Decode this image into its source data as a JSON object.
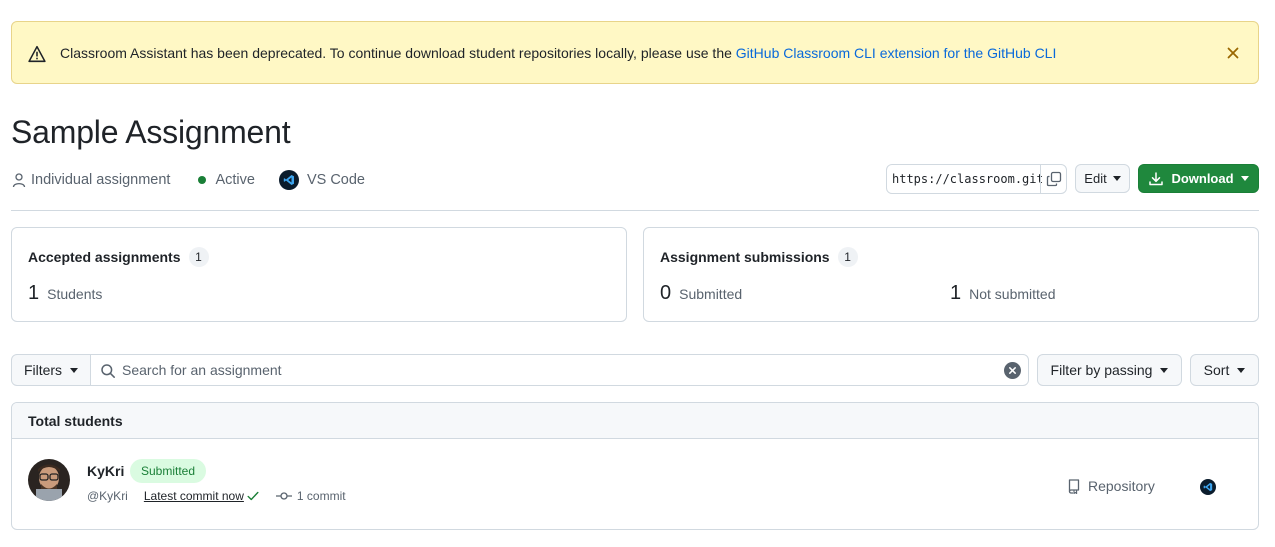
{
  "banner": {
    "message": "Classroom Assistant has been deprecated. To continue download student repositories locally, please use the ",
    "link_text": "GitHub Classroom CLI extension for the GitHub CLI",
    "icon": "alert-icon",
    "close_icon": "close-icon"
  },
  "assignment": {
    "title": "Sample Assignment",
    "type_label": "Individual assignment",
    "status_label": "Active",
    "editor_label": "VS Code",
    "invite_url": "https://classroom.github.com/a/",
    "edit_label": "Edit",
    "download_label": "Download"
  },
  "stats": {
    "accepted": {
      "heading": "Accepted assignments",
      "count": "1",
      "students_num": "1",
      "students_label": "Students"
    },
    "submissions": {
      "heading": "Assignment submissions",
      "count": "1",
      "submitted_num": "0",
      "submitted_label": "Submitted",
      "not_submitted_num": "1",
      "not_submitted_label": "Not submitted"
    }
  },
  "filters": {
    "filters_label": "Filters",
    "search_placeholder": "Search for an assignment",
    "passing_label": "Filter by passing",
    "sort_label": "Sort"
  },
  "table": {
    "header": "Total students",
    "rows": [
      {
        "name": "KyKri",
        "status": "Submitted",
        "handle": "@KyKri",
        "latest_commit": "Latest commit now",
        "commits": "1 commit",
        "repo_label": "Repository"
      }
    ]
  },
  "colors": {
    "banner_bg": "#fff8c5",
    "primary_green": "#1f883d",
    "link_blue": "#0969da",
    "success_badge_bg": "#dafbe1"
  }
}
